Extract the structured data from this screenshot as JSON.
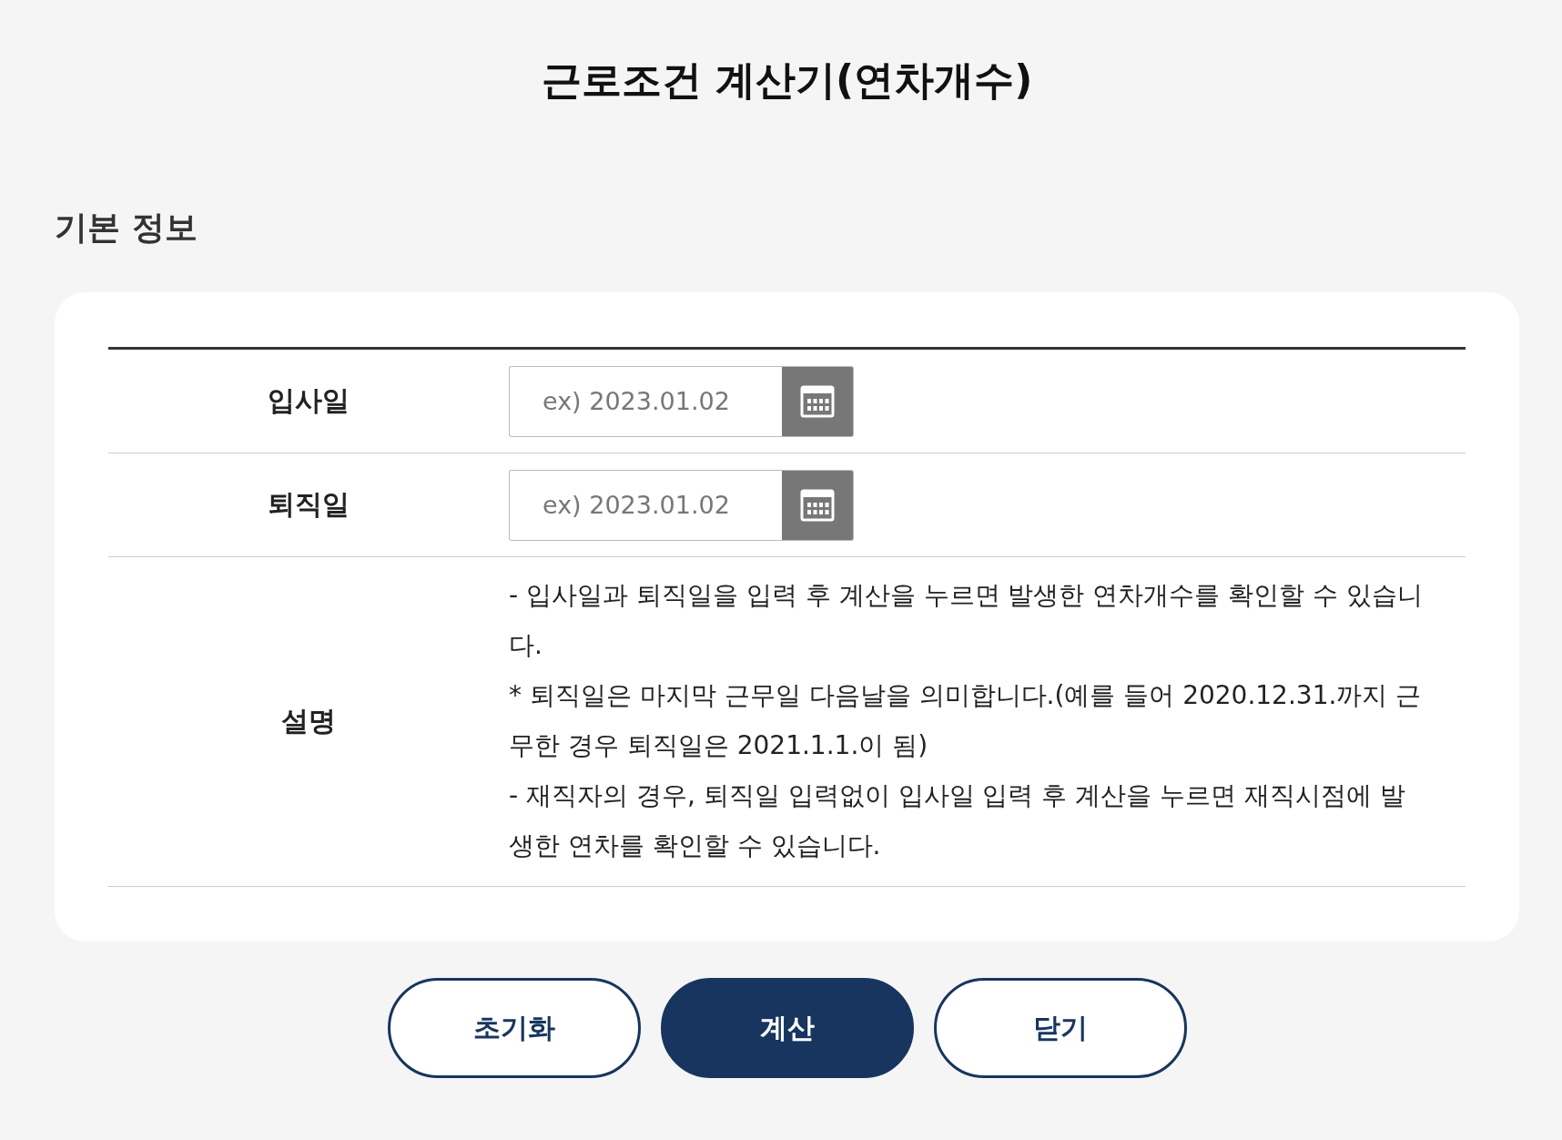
{
  "title": "근로조건 계산기(연차개수)",
  "section_title": "기본 정보",
  "fields": [
    {
      "label": "입사일",
      "placeholder": "ex) 2023.01.02"
    },
    {
      "label": "퇴직일",
      "placeholder": "ex) 2023.01.02"
    }
  ],
  "description": {
    "label": "설명",
    "paragraphs": [
      "- 입사일과 퇴직일을 입력 후 계산을 누르면 발생한 연차개수를 확인할 수 있습니다.",
      "* 퇴직일은 마지막 근무일 다음날을 의미합니다.(예를 들어 2020.12.31.까지 근무한 경우 퇴직일은 2021.1.1.이 됨)",
      "- 재직자의 경우, 퇴직일 입력없이 입사일 입력 후 계산을 누르면 재직시점에 발생한 연차를 확인할 수 있습니다."
    ]
  },
  "buttons": [
    {
      "label": "초기화",
      "kind": "outline"
    },
    {
      "label": "계산",
      "kind": "primary"
    },
    {
      "label": "닫기",
      "kind": "outline"
    }
  ]
}
